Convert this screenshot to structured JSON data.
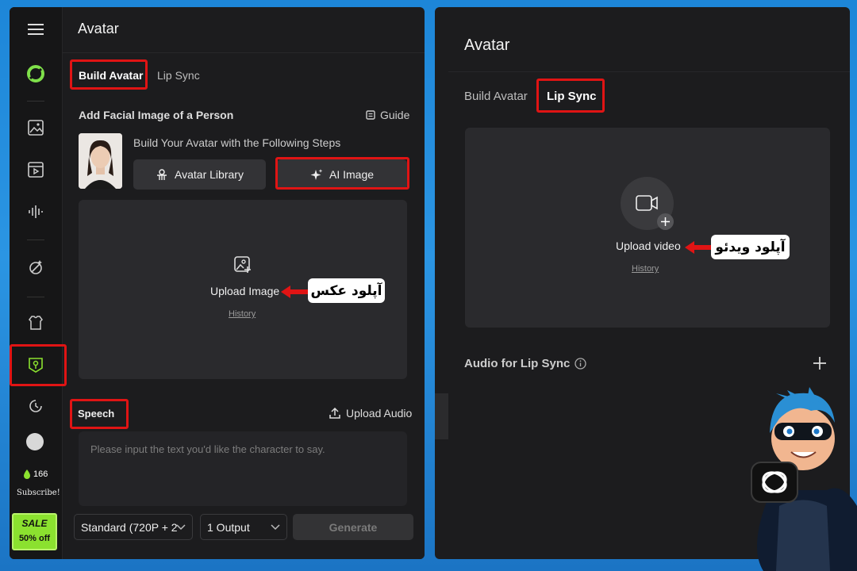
{
  "left": {
    "title": "Avatar",
    "tabs": [
      "Build Avatar",
      "Lip Sync"
    ],
    "facial_heading": "Add Facial Image of a Person",
    "guide_label": "Guide",
    "steps_text": "Build Your Avatar with the Following Steps",
    "avatar_library_label": "Avatar Library",
    "ai_image_label": "AI Image",
    "upload_image_label": "Upload Image",
    "history_label": "History",
    "persian_upload_image": "آپلود عکس",
    "speech_label": "Speech",
    "upload_audio_label": "Upload Audio",
    "speech_placeholder": "Please input the text you'd like the character to say.",
    "quality_select": "Standard (720P + 2",
    "output_select": "1 Output",
    "generate_label": "Generate",
    "credits": "166",
    "subscribe_label": "Subscribe!",
    "sale_label": "SALE",
    "discount_label": "50% off"
  },
  "right": {
    "title": "Avatar",
    "tabs": [
      "Build Avatar",
      "Lip Sync"
    ],
    "upload_video_label": "Upload video",
    "history_label": "History",
    "persian_upload_video": "آپلود ویدئو",
    "audio_heading": "Audio for Lip Sync"
  },
  "colors": {
    "panel_bg": "#1c1c1e",
    "highlight_red": "#e01414",
    "sale_green": "#8be12f"
  },
  "icons": [
    "menu-icon",
    "logo-icon",
    "image-icon",
    "video-icon",
    "audio-wave-icon",
    "magic-icon",
    "shirt-icon",
    "avatar-icon",
    "history-icon",
    "user-avatar",
    "flame-icon",
    "guide-icon",
    "person-icon",
    "sparkle-icon",
    "image-add-icon",
    "upload-icon",
    "chevron-down-icon",
    "camera-icon",
    "plus-icon",
    "info-icon"
  ]
}
